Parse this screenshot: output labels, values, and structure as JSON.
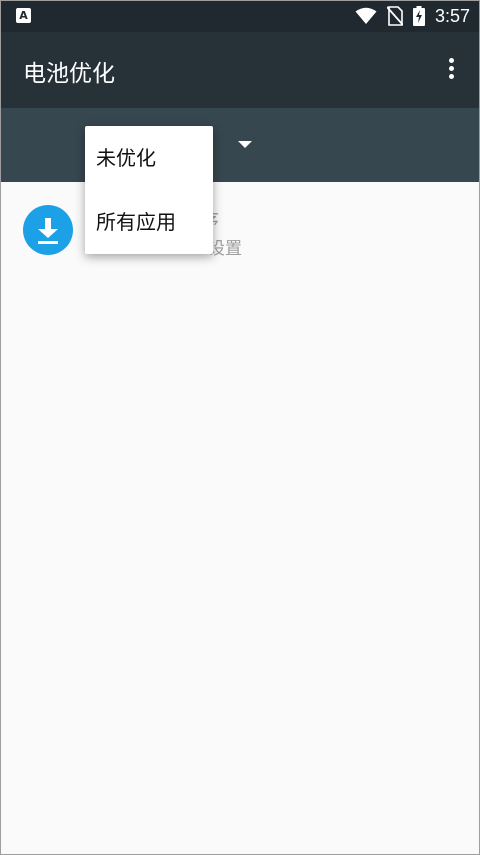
{
  "status_bar": {
    "time": "3:57",
    "notification_icon_letter": "A",
    "icons": [
      "wifi-icon",
      "no-sim-icon",
      "battery-charging-icon"
    ]
  },
  "app_bar": {
    "title": "电池优化",
    "menu_icon": "more-vert-icon"
  },
  "filter": {
    "dropdown_icon": "dropdown-arrow-icon"
  },
  "popup_menu": {
    "items": [
      {
        "label": "未优化"
      },
      {
        "label": "所有应用"
      }
    ]
  },
  "app_list": [
    {
      "name_visible": "序",
      "status_visible": "设置",
      "icon": "download-icon",
      "icon_color": "#1da1e6"
    }
  ],
  "colors": {
    "status_bar": "#1f292f",
    "app_bar": "#263238",
    "filter_bar": "#37474f",
    "background": "#fafafa"
  }
}
